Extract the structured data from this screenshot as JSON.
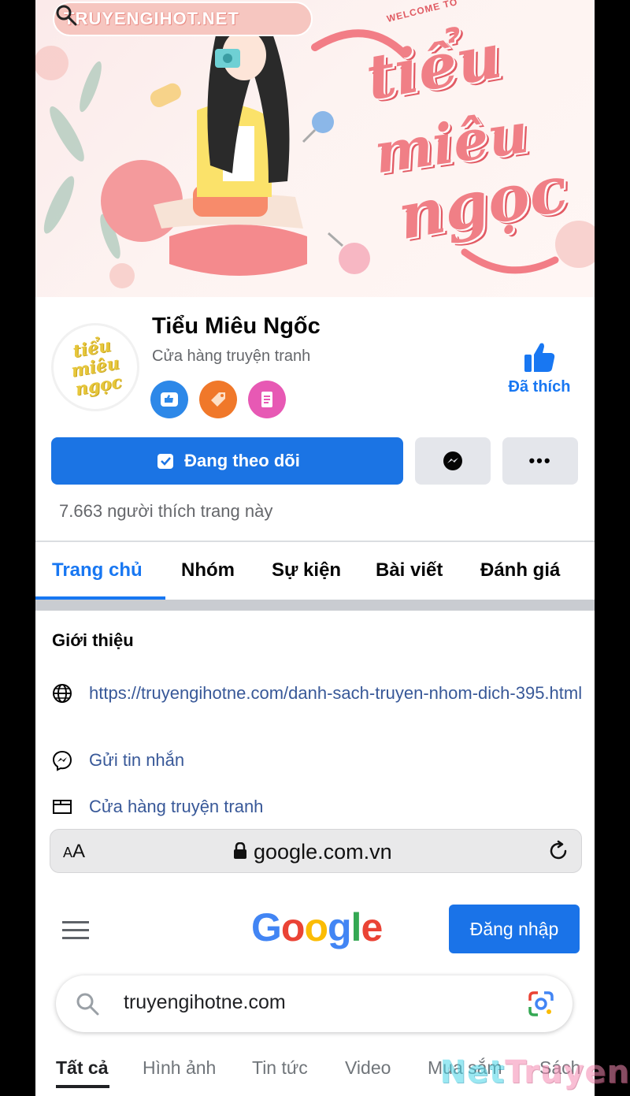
{
  "cover": {
    "site_label": "TRUYENGIHOT.NET",
    "welcome": "WELCOME TO",
    "script_line1": "tiểu",
    "script_line2": "miêu",
    "script_line3": "ngọc"
  },
  "profile": {
    "avatar_text": "tiểu miêu ngọc",
    "name": "Tiểu Miêu Ngốc",
    "category": "Cửa hàng truyện tranh",
    "liked_label": "Đã thích",
    "follow_label": "Đang theo dõi",
    "more_label": "•••",
    "likes_count": "7.663 người thích trang này"
  },
  "tabs": [
    {
      "label": "Trang chủ"
    },
    {
      "label": "Nhóm"
    },
    {
      "label": "Sự kiện"
    },
    {
      "label": "Bài viết"
    },
    {
      "label": "Đánh giá"
    }
  ],
  "intro": {
    "title": "Giới thiệu",
    "website": "https://truyengihotne.com/danh-sach-truyen-nhom-dich-395.html",
    "message": "Gửi tin nhắn",
    "shop": "Cửa hàng truyện tranh"
  },
  "safari": {
    "aa_small": "A",
    "aa_large": "A",
    "url": "google.com.vn"
  },
  "google": {
    "logo": [
      "G",
      "o",
      "o",
      "g",
      "l",
      "e"
    ],
    "logo_colors": [
      "#4285f4",
      "#ea4335",
      "#fbbc05",
      "#4285f4",
      "#34a853",
      "#ea4335"
    ],
    "signin_label": "Đăng nhập",
    "search_value": "truyengihotne.com",
    "tabs": [
      "Tất cả",
      "Hình ảnh",
      "Tin tức",
      "Video",
      "Mua sắm",
      "Sách"
    ]
  },
  "watermark": {
    "part1": "Net",
    "part2": "Truyen"
  },
  "colors": {
    "facebook_blue": "#1877f2",
    "link_blue": "#385898",
    "google_blue": "#1a73e8"
  }
}
